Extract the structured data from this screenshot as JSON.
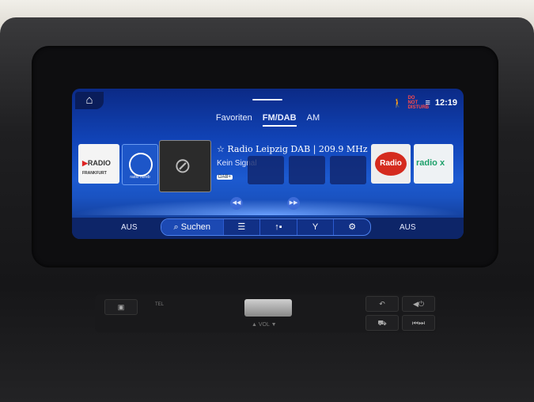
{
  "status": {
    "time": "12:19",
    "dnd_label": "DO NOT DISTURB",
    "icons": [
      "person-icon",
      "do-not-disturb-icon",
      "seat-icon"
    ]
  },
  "tabs": [
    {
      "label": "Favoriten",
      "active": false
    },
    {
      "label": "FM/DAB",
      "active": true
    },
    {
      "label": "AM",
      "active": false
    }
  ],
  "stations": {
    "radio_frankfurt": {
      "name": "RADIO",
      "sub": "FRANKFURT"
    },
    "radio_horeb": {
      "name": "radio horeb"
    },
    "radio_ton": {
      "name": "Radio Ton"
    },
    "radio_x": {
      "name": "radio x"
    }
  },
  "now_playing": {
    "title": "☆ Radio Leipzig DAB | 209.9 MHz",
    "signal": "Kein Signal",
    "badge": "DAB+"
  },
  "bottom": {
    "left_status": "AUS",
    "right_status": "AUS",
    "search_label": "Suchen"
  },
  "controls": {
    "icons": [
      "list-icon",
      "station-up-icon",
      "antenna-icon",
      "settings-icon"
    ]
  },
  "physical": {
    "tel": "TEL",
    "vol": "▲ VOL ▼"
  },
  "colors": {
    "screen_blue": "#1144b8",
    "bar_blue": "#0d2568"
  }
}
